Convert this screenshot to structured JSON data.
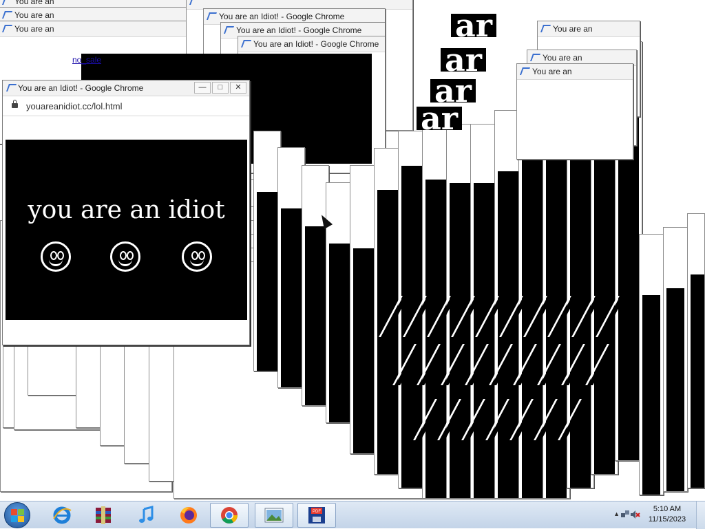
{
  "window_title": "You are an Idiot! - Google Chrome",
  "window_title_partial": "You are an",
  "address_url": "youareanidiot.cc/lol.html",
  "link_fragment": "no_sale",
  "page_message": "you are an idiot",
  "big_letters": "ar",
  "caption_buttons": {
    "minimize": "—",
    "maximize": "□",
    "close": "✕"
  },
  "taskbar": {
    "items": [
      {
        "name": "start-button",
        "icon": "windows-orb-icon"
      },
      {
        "name": "internet-explorer",
        "icon": "ie-icon"
      },
      {
        "name": "winrar",
        "icon": "archive-icon"
      },
      {
        "name": "itunes",
        "icon": "music-note-icon"
      },
      {
        "name": "firefox",
        "icon": "firefox-icon"
      },
      {
        "name": "chrome",
        "icon": "chrome-icon",
        "active": true
      },
      {
        "name": "photo-viewer",
        "icon": "picture-icon"
      },
      {
        "name": "pdf-save",
        "icon": "pdf-floppy-icon"
      }
    ],
    "clock_time": "5:10 AM",
    "clock_date": "11/15/2023"
  }
}
